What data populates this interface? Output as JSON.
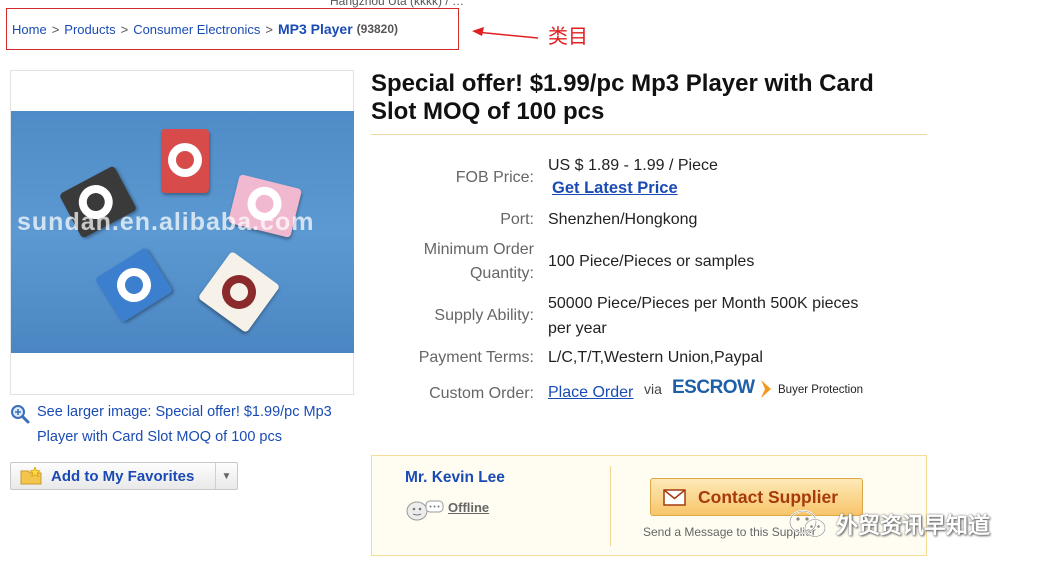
{
  "top_cut_text": "Hangzhou Utà (ĸĸĸĸ) / …",
  "breadcrumb": {
    "items": [
      "Home",
      "Products",
      "Consumer Electronics"
    ],
    "current": "MP3 Player",
    "count": "(93820)"
  },
  "annotation": {
    "label": "类目",
    "color": "#e02020"
  },
  "image": {
    "watermark": "sundan.en.alibaba.com",
    "see_larger": "See larger image: Special offer! $1.99/pc Mp3 Player with Card Slot MOQ of 100 pcs"
  },
  "favorites": {
    "label": "Add to My Favorites"
  },
  "product": {
    "title": "Special offer! $1.99/pc Mp3 Player with Card Slot MOQ of 100 pcs"
  },
  "specs": {
    "fob_label": "FOB Price:",
    "fob_value": "US $ 1.89 - 1.99 / Piece",
    "latest_price": "Get Latest Price",
    "port_label": "Port:",
    "port_value": "Shenzhen/Hongkong",
    "moq_label_1": "Minimum Order",
    "moq_label_2": "Quantity:",
    "moq_value": "100 Piece/Pieces or samples",
    "supply_label": "Supply Ability:",
    "supply_value_1": "50000 Piece/Pieces per Month 500K pieces",
    "supply_value_2": "per year",
    "payment_label": "Payment Terms:",
    "payment_value": "L/C,T/T,Western Union,Paypal",
    "custom_label": "Custom Order:",
    "place_order": "Place Order",
    "via": "via",
    "escrow": "ESCROW",
    "buyer_protection": "Buyer Protection"
  },
  "contact": {
    "rep_name": "Mr. Kevin Lee",
    "status": "Offline",
    "button_label": "Contact Supplier",
    "send_message": "Send a Message to this Supplier"
  },
  "wechat_watermark": "外贸资讯早知道",
  "colors": {
    "link": "#1a4bb5",
    "highlight_border": "#d42a2a",
    "contact_button": "#f8c56a",
    "title": "#111111"
  }
}
